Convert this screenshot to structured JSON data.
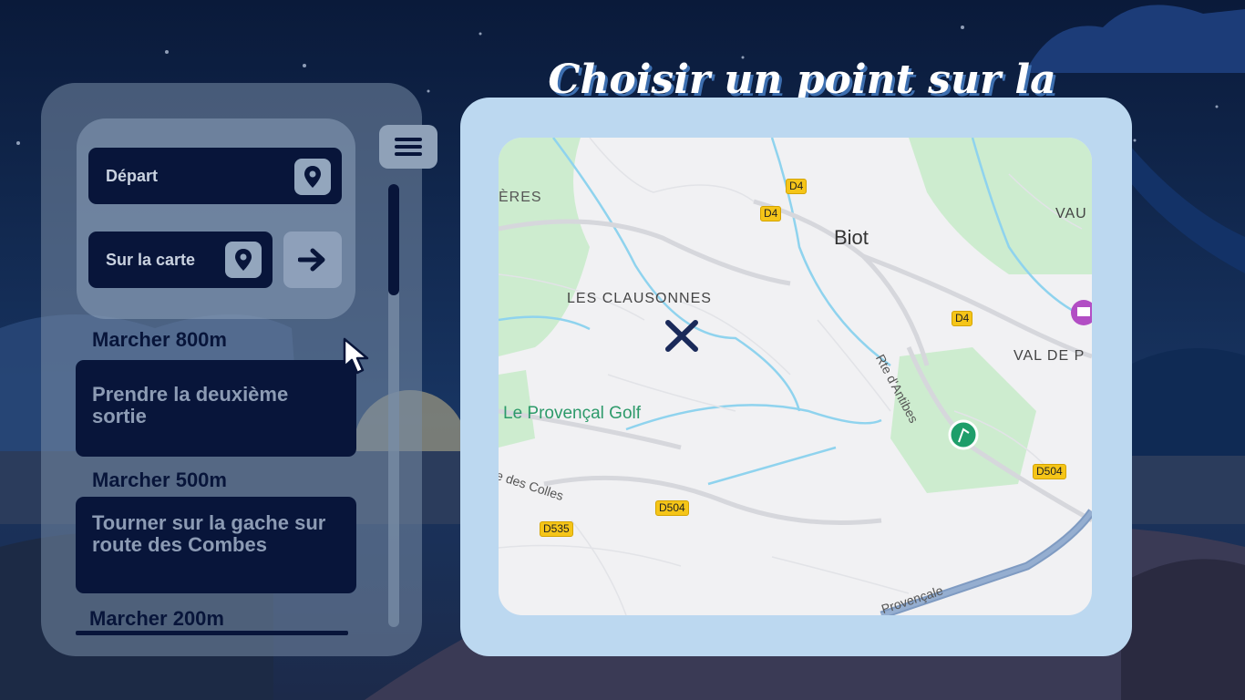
{
  "title": "Choisir un point sur la Carte",
  "form": {
    "departure_label": "Départ",
    "destination_label": "Sur la carte"
  },
  "steps": [
    {
      "distance": "Marcher 800m",
      "instruction": "Prendre la deuxième sortie"
    },
    {
      "distance": "Marcher 500m",
      "instruction": "Tourner sur la gache sur route des Combes"
    },
    {
      "distance": "Marcher 200m"
    }
  ],
  "map": {
    "places": {
      "eres": "ÈRES",
      "clausonnes": "LES CLAUSONNES",
      "biot": "Biot",
      "vau": "VAU",
      "val": "VAL DE P",
      "golf": "Le Provençal Golf",
      "route_colles": "e des Colles",
      "rte_antibes": "Rte d'Antibes",
      "provencale": "Provençale"
    },
    "roads": {
      "d4_a": "D4",
      "d4_b": "D4",
      "d4_c": "D4",
      "d504_a": "D504",
      "d504_b": "D504",
      "d535": "D535"
    },
    "marker": "close-x-marker"
  },
  "icons": {
    "pin": "map-pin-icon",
    "arrow": "arrow-right-icon",
    "menu": "hamburger-menu-icon",
    "cursor": "mouse-pointer-icon"
  },
  "colors": {
    "navy": "#08153a",
    "map_frame": "#bcd8f0",
    "title_shadow": "#3d6fb0"
  }
}
